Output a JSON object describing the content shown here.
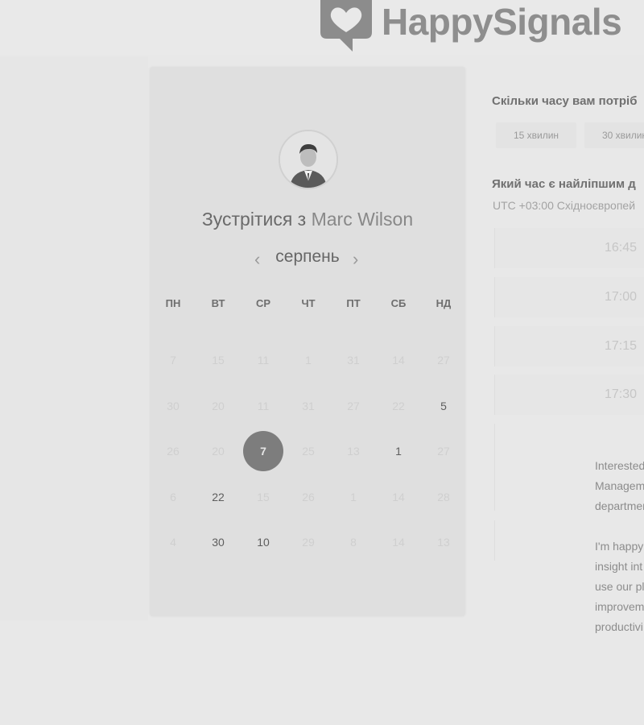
{
  "brand": {
    "name": "HappySignals"
  },
  "meeting": {
    "title_prefix": "Зустрітися з",
    "host_name": "Marc Wilson"
  },
  "calendar": {
    "month": "серпень",
    "weekdays": [
      "ПН",
      "ВТ",
      "СР",
      "ЧТ",
      "ПТ",
      "СБ",
      "НД"
    ],
    "rows": [
      [
        {
          "d": "7",
          "s": "disabled"
        },
        {
          "d": "15",
          "s": "disabled"
        },
        {
          "d": "11",
          "s": "disabled"
        },
        {
          "d": "1",
          "s": "disabled"
        },
        {
          "d": "31",
          "s": "disabled"
        },
        {
          "d": "14",
          "s": "disabled"
        },
        {
          "d": "27",
          "s": "disabled"
        }
      ],
      [
        {
          "d": "30",
          "s": "disabled"
        },
        {
          "d": "20",
          "s": "disabled"
        },
        {
          "d": "11",
          "s": "disabled"
        },
        {
          "d": "31",
          "s": "disabled"
        },
        {
          "d": "27",
          "s": "disabled"
        },
        {
          "d": "22",
          "s": "disabled"
        },
        {
          "d": "5",
          "s": "available"
        }
      ],
      [
        {
          "d": "26",
          "s": "disabled"
        },
        {
          "d": "20",
          "s": "disabled"
        },
        {
          "d": "7",
          "s": "selected"
        },
        {
          "d": "25",
          "s": "disabled"
        },
        {
          "d": "13",
          "s": "disabled"
        },
        {
          "d": "1",
          "s": "available"
        },
        {
          "d": "27",
          "s": "disabled"
        }
      ],
      [
        {
          "d": "6",
          "s": "disabled"
        },
        {
          "d": "22",
          "s": "available"
        },
        {
          "d": "15",
          "s": "disabled"
        },
        {
          "d": "26",
          "s": "disabled"
        },
        {
          "d": "1",
          "s": "disabled"
        },
        {
          "d": "14",
          "s": "disabled"
        },
        {
          "d": "28",
          "s": "disabled"
        }
      ],
      [
        {
          "d": "4",
          "s": "disabled"
        },
        {
          "d": "30",
          "s": "available"
        },
        {
          "d": "10",
          "s": "available"
        },
        {
          "d": "29",
          "s": "disabled"
        },
        {
          "d": "8",
          "s": "disabled"
        },
        {
          "d": "14",
          "s": "disabled"
        },
        {
          "d": "13",
          "s": "disabled"
        }
      ]
    ]
  },
  "duration": {
    "question": "Скільки часу вам потріб",
    "options": [
      "15 хвилин",
      "30 хвилин"
    ]
  },
  "time": {
    "question": "Який час є найліпшим д",
    "timezone": "UTC +03:00 Східноєвропей",
    "slots": [
      "16:45",
      "17:00",
      "17:15",
      "17:30"
    ]
  },
  "description": {
    "para1": [
      "Interested",
      "Managem",
      "departmen"
    ],
    "para2": [
      "I'm happy",
      "insight int",
      "use our pl",
      "improvem",
      "productivi"
    ]
  },
  "colors": {
    "background": "#e8e8e8",
    "card": "#dfdfdf",
    "selected_day": "#7d7d7d"
  }
}
